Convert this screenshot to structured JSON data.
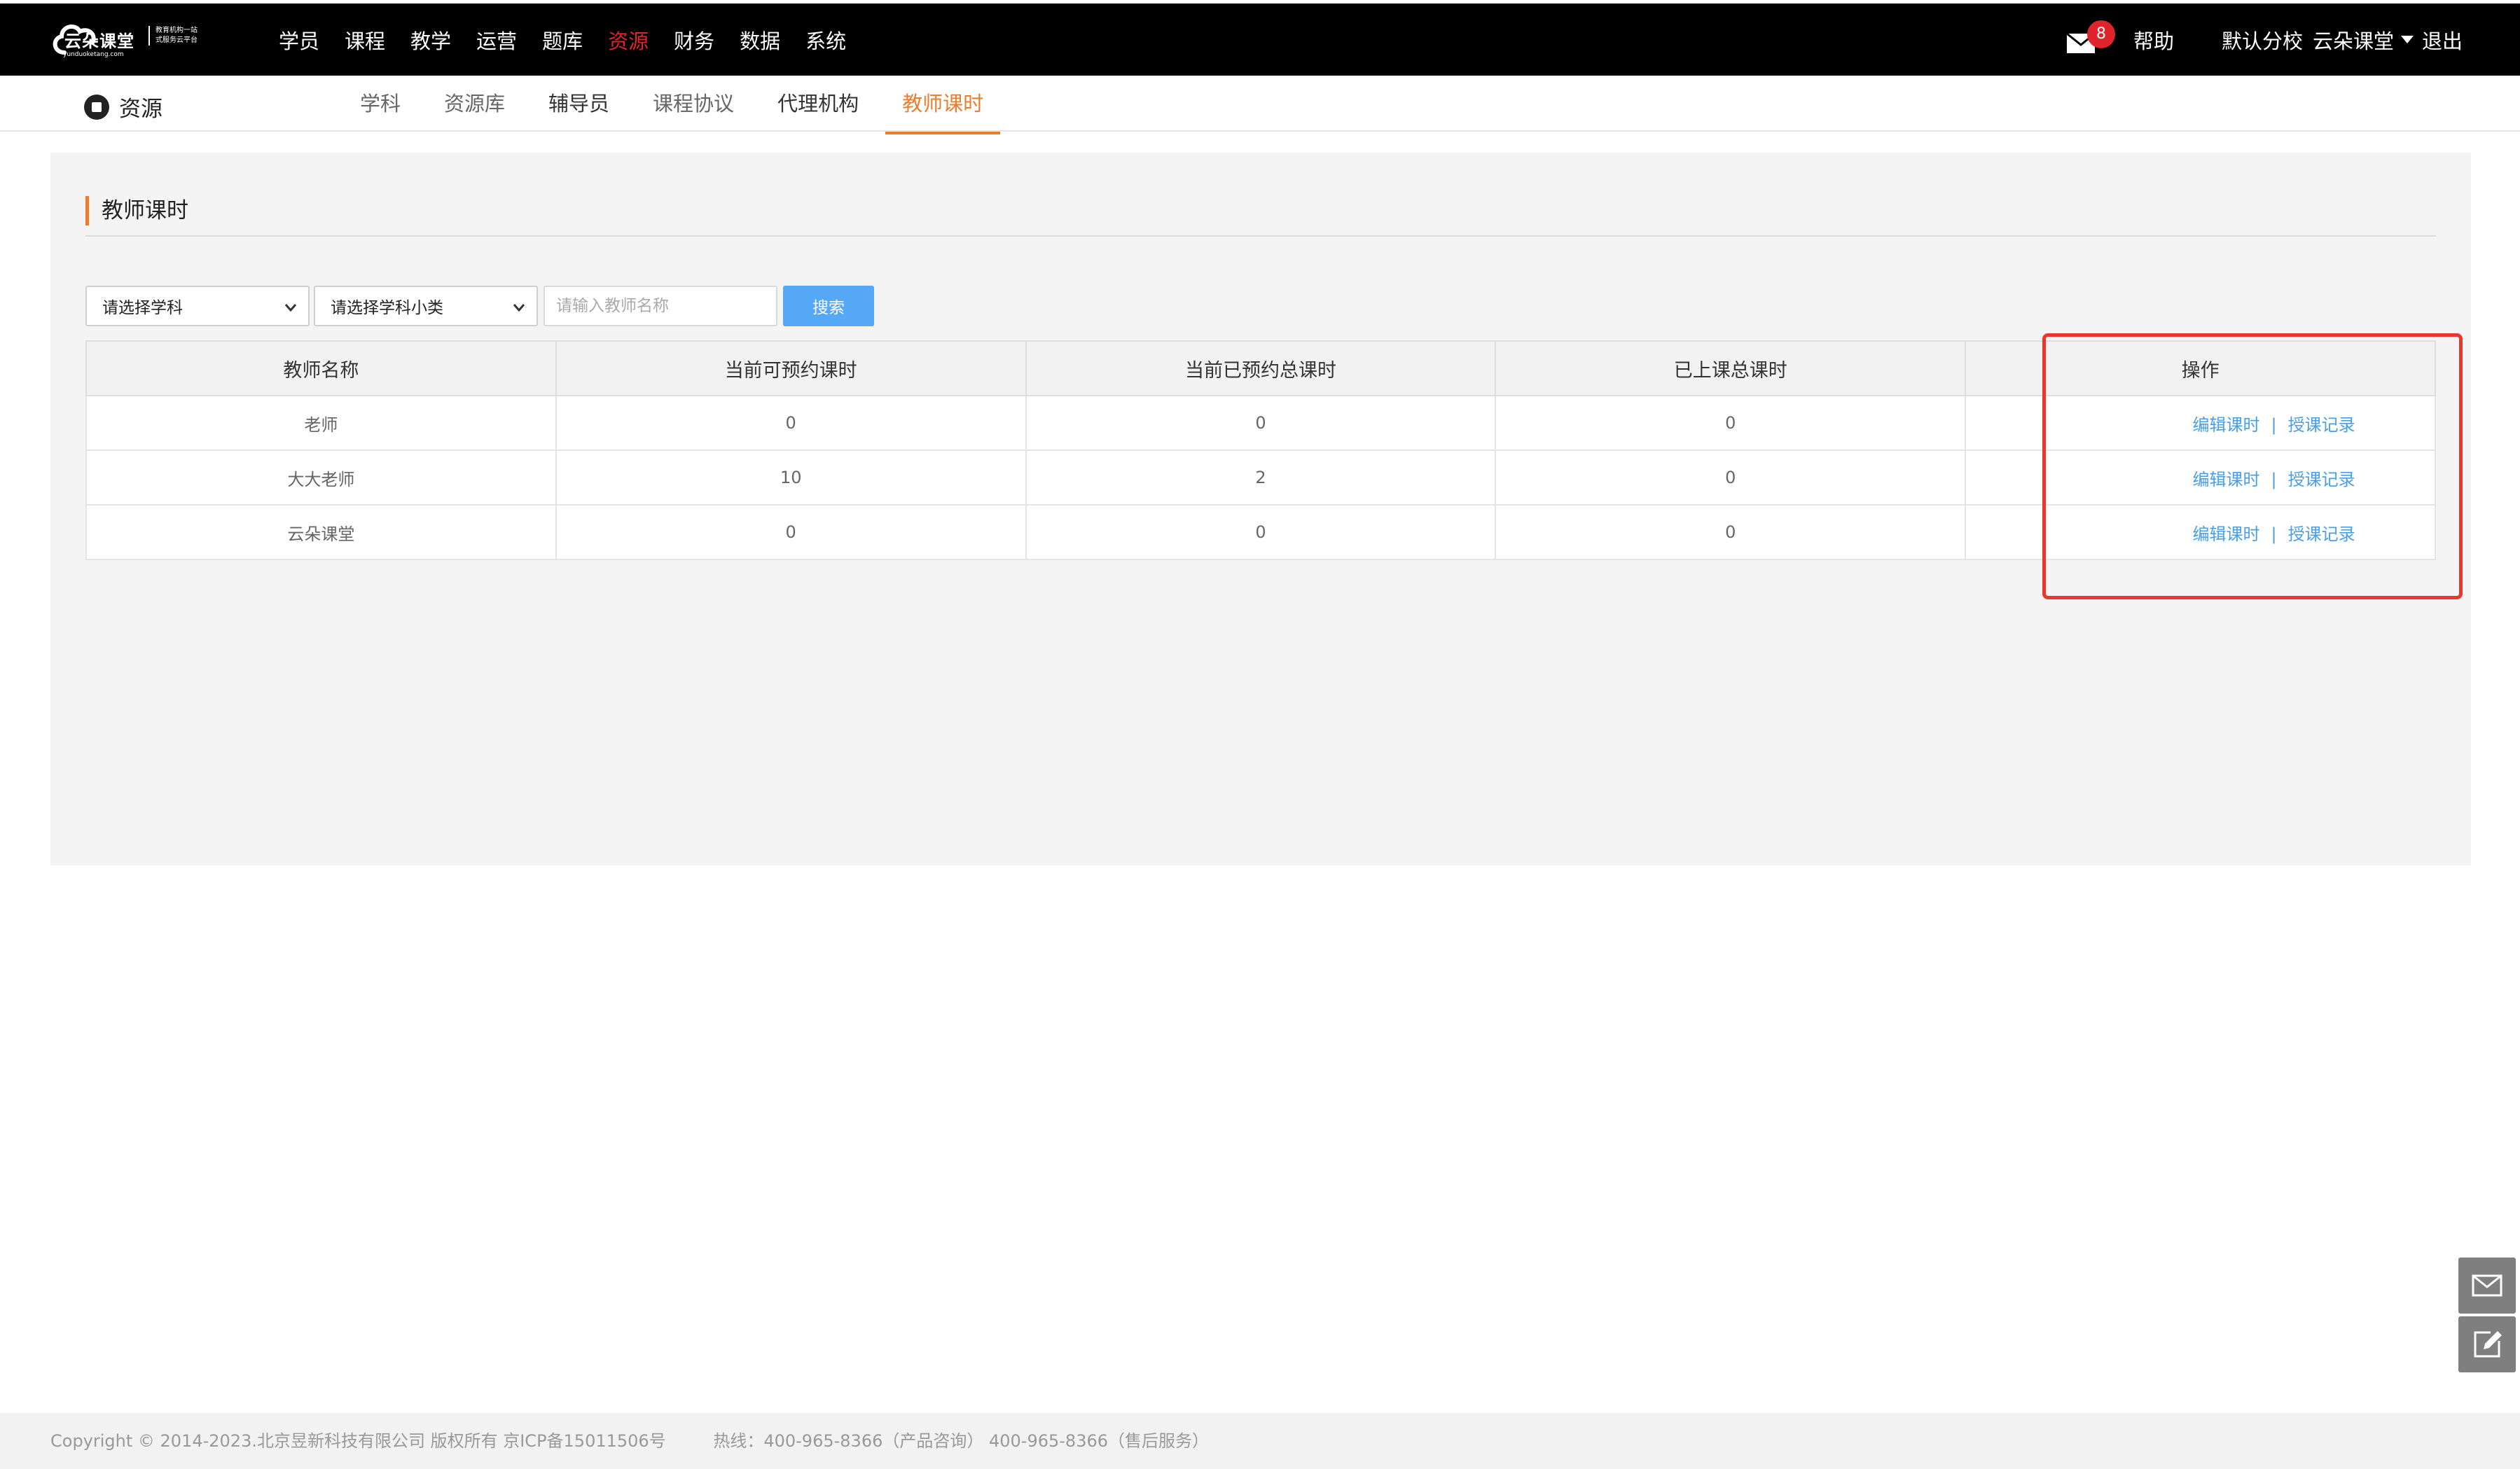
{
  "topbar": {
    "logo_text": "云朵课堂",
    "logo_sub_line1": "教育机构一站",
    "logo_sub_line2": "式服务云平台",
    "logo_url": "yunduoketang.com",
    "nav": [
      "学员",
      "课程",
      "教学",
      "运营",
      "题库",
      "资源",
      "财务",
      "数据",
      "系统"
    ],
    "active_nav": "资源",
    "mail_count": "8",
    "help": "帮助",
    "branch": "默认分校",
    "user": "云朵课堂",
    "logout": "退出"
  },
  "subnav": {
    "section": "资源",
    "tabs": [
      "学科",
      "资源库",
      "辅导员",
      "课程协议",
      "代理机构",
      "教师课时"
    ],
    "active_tab": "教师课时"
  },
  "panel": {
    "title": "教师课时",
    "filter_subject": "请选择学科",
    "filter_subcategory": "请选择学科小类",
    "search_placeholder": "请输入教师名称",
    "search_button": "搜索"
  },
  "table": {
    "headers": [
      "教师名称",
      "当前可预约课时",
      "当前已预约总课时",
      "已上课总课时",
      "操作"
    ],
    "rows": [
      {
        "name": "老师",
        "available": "0",
        "booked": "0",
        "taught": "0"
      },
      {
        "name": "大大老师",
        "available": "10",
        "booked": "2",
        "taught": "0"
      },
      {
        "name": "云朵课堂",
        "available": "0",
        "booked": "0",
        "taught": "0"
      }
    ],
    "action_edit": "编辑课时",
    "action_sep": "|",
    "action_records": "授课记录"
  },
  "footer": {
    "copyright": "Copyright © 2014-2023.北京昱新科技有限公司 版权所有 京ICP备15011506号",
    "hotline": "热线：400-965-8366（产品咨询） 400-965-8366（售后服务）"
  },
  "colors": {
    "accent": "#ee7c2d",
    "nav_active": "#e0242c",
    "link": "#4a9ee8",
    "button": "#55a8f5",
    "highlight": "#e8372c"
  }
}
